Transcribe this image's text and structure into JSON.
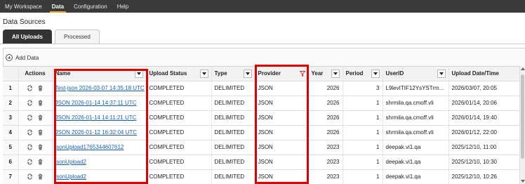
{
  "topnav": {
    "items": [
      {
        "label": "My Workspace",
        "active": false
      },
      {
        "label": "Data",
        "active": true
      },
      {
        "label": "Configuration",
        "active": false
      },
      {
        "label": "Help",
        "active": false
      }
    ]
  },
  "page": {
    "title": "Data Sources"
  },
  "tabs": [
    {
      "label": "All Uploads",
      "active": true
    },
    {
      "label": "Processed",
      "active": false
    }
  ],
  "toolbar": {
    "add_label": "Add Data",
    "add_icon": "plus-circle-icon"
  },
  "colors": {
    "highlight": "#e00000",
    "link": "#1a5fb4",
    "nav_bg": "#3a3a3a",
    "nav_accent": "#f0a020"
  },
  "table": {
    "columns": [
      {
        "key": "rownum",
        "label": ""
      },
      {
        "key": "actions",
        "label": "Actions"
      },
      {
        "key": "name",
        "label": "Name"
      },
      {
        "key": "status",
        "label": "Upload Status"
      },
      {
        "key": "type",
        "label": "Type"
      },
      {
        "key": "provider",
        "label": "Provider"
      },
      {
        "key": "year",
        "label": "Year"
      },
      {
        "key": "period",
        "label": "Period"
      },
      {
        "key": "userid",
        "label": "UserID"
      },
      {
        "key": "date",
        "label": "Upload Date/Time"
      }
    ],
    "rows": [
      {
        "rownum": "1",
        "name": "Test-json 2026-03-07 14:35:18 UTC",
        "status": "COMPLETED",
        "type": "DELIMITED",
        "provider": "JSON",
        "year": "2026",
        "period": "3",
        "userid": "L9levITIF12YsYSTrm...",
        "date": "2026/03/07, 20:05"
      },
      {
        "rownum": "2",
        "name": "JSON 2026-01-14 14:37:11 UTC",
        "status": "COMPLETED",
        "type": "DELIMITED",
        "provider": "JSON",
        "year": "2026",
        "period": "1",
        "userid": "shrmila.qa.cmoff.vli",
        "date": "2026/01/14, 20:06"
      },
      {
        "rownum": "3",
        "name": "JSON 2026-01-14 14:11:21 UTC",
        "status": "COMPLETED",
        "type": "DELIMITED",
        "provider": "JSON",
        "year": "2026",
        "period": "1",
        "userid": "shrmila.qa.cmoff.vli",
        "date": "2026/01/14, 19:40"
      },
      {
        "rownum": "4",
        "name": "JSON 2026-01-12 16:32:04 UTC",
        "status": "COMPLETED",
        "type": "DELIMITED",
        "provider": "JSON",
        "year": "2026",
        "period": "1",
        "userid": "shrmila.qa.cmoff.vli",
        "date": "2026/01/12, 22:00"
      },
      {
        "rownum": "5",
        "name": "jsonUpload1765344607612",
        "status": "COMPLETED",
        "type": "DELIMITED",
        "provider": "JSON",
        "year": "2023",
        "period": "1",
        "userid": "deepak.vi1.qa",
        "date": "2025/12/10, 11:00"
      },
      {
        "rownum": "6",
        "name": "jsonUpload2",
        "status": "COMPLETED",
        "type": "DELIMITED",
        "provider": "JSON",
        "year": "2023",
        "period": "1",
        "userid": "deepak.vi1.qa",
        "date": "2025/12/10, 10:30"
      },
      {
        "rownum": "7",
        "name": "jsonUpload2",
        "status": "COMPLETED",
        "type": "DELIMITED",
        "provider": "JSON",
        "year": "2023",
        "period": "1",
        "userid": "deepak.vi1.qa",
        "date": "2025/12/10, 10:26"
      }
    ]
  }
}
